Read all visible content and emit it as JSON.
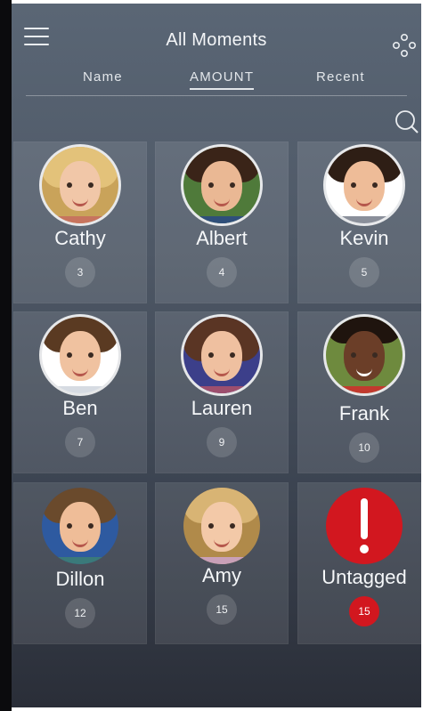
{
  "header": {
    "title": "All Moments"
  },
  "sort_tabs": [
    {
      "label": "Name"
    },
    {
      "label": "AMOUNT",
      "active": true
    },
    {
      "label": "Recent"
    }
  ],
  "icons": {
    "menu": "hamburger-menu-icon",
    "options": "dots-cluster-icon",
    "search": "search-icon",
    "untagged": "exclamation-alert-icon"
  },
  "colors": {
    "accent_red": "#d2171f",
    "text": "#f5f7f9"
  },
  "tiles": [
    {
      "name": "Cathy",
      "count": "3"
    },
    {
      "name": "Albert",
      "count": "4"
    },
    {
      "name": "Kevin",
      "count": "5"
    },
    {
      "name": "Ben",
      "count": "7"
    },
    {
      "name": "Lauren",
      "count": "9"
    },
    {
      "name": "Frank",
      "count": "10"
    },
    {
      "name": "Dillon",
      "count": "12"
    },
    {
      "name": "Amy",
      "count": "15"
    },
    {
      "name": "Untagged",
      "count": "15"
    }
  ]
}
